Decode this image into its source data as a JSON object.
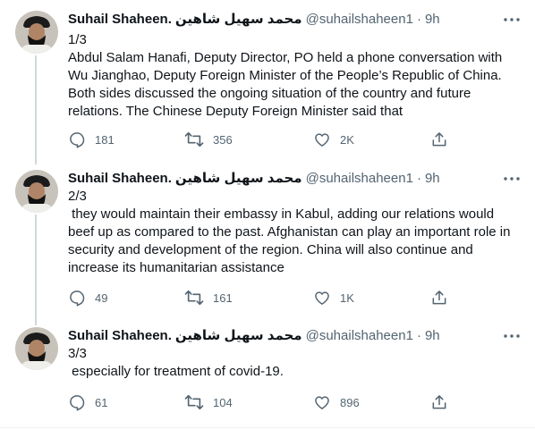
{
  "author": {
    "name": "Suhail Shaheen.",
    "name_arabic": "محمد سهیل شاهین",
    "handle": "@suhailshaheen1",
    "separator": "·"
  },
  "tweets": [
    {
      "time": "9h",
      "lines": [
        "1/3",
        "Abdul Salam Hanafi, Deputy Director,  PO held a phone conversation with",
        "Wu Jianghao, Deputy Foreign Minister of the People’s Republic of China.",
        "Both sides discussed the ongoing situation of the country and future",
        "relations. The Chinese Deputy Foreign Minister said that"
      ],
      "replies": "181",
      "retweets": "356",
      "likes": "2K"
    },
    {
      "time": "9h",
      "lines": [
        "2/3",
        " they would maintain their embassy in Kabul, adding our relations would",
        "beef up as compared to the past. Afghanistan can play an important role in",
        "security and development of the region. China will also continue and",
        "increase its humanitarian assistance"
      ],
      "replies": "49",
      "retweets": "161",
      "likes": "1K"
    },
    {
      "time": "9h",
      "lines": [
        "3/3",
        " especially for treatment of covid-19."
      ],
      "replies": "61",
      "retweets": "104",
      "likes": "896"
    }
  ],
  "icons": {
    "reply": "reply-icon",
    "retweet": "retweet-icon",
    "like": "like-icon",
    "share": "share-icon",
    "more": "more-icon"
  },
  "colors": {
    "text": "#0f1419",
    "secondary": "#536471",
    "thread_line": "#cfd9de"
  }
}
